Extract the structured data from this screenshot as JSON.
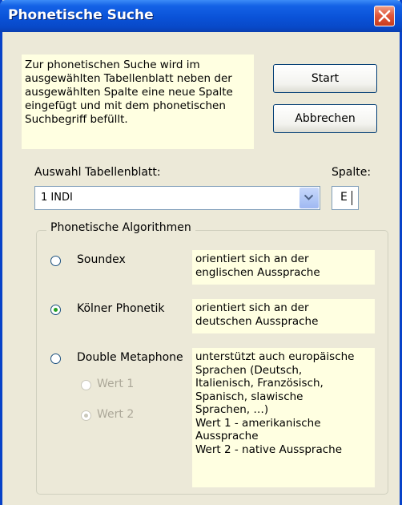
{
  "window": {
    "title": "Phonetische Suche"
  },
  "info_text": "Zur phonetischen Suche wird im ausgewählten Tabellenblatt neben der ausgewählten Spalte eine neue Spalte eingefügt und mit dem phonetischen Suchbegriff befüllt.",
  "buttons": {
    "start": "Start",
    "cancel": "Abbrechen"
  },
  "sheet_select": {
    "label": "Auswahl Tabellenblatt:",
    "value": "1 INDI"
  },
  "column_field": {
    "label": "Spalte:",
    "value": "E"
  },
  "algorithms": {
    "group_label": "Phonetische Algorithmen",
    "options": [
      {
        "label": "Soundex",
        "selected": false,
        "description": "orientiert sich an der\nenglischen Aussprache"
      },
      {
        "label": "Kölner Phonetik",
        "selected": true,
        "description": "orientiert sich an der\ndeutschen Aussprache"
      },
      {
        "label": "Double Metaphone",
        "selected": false,
        "description": "unterstützt auch europäische\nSprachen (Deutsch,\nItalienisch, Französisch,\nSpanisch, slawische\nSprachen, …)\nWert 1 - amerikanische\nAussprache\nWert 2 - native Aussprache"
      }
    ],
    "sub_options": [
      {
        "label": "Wert 1",
        "selected": false,
        "enabled": false
      },
      {
        "label": "Wert 2",
        "selected": true,
        "enabled": false
      }
    ]
  },
  "colors": {
    "titlebar": "#0a52d8",
    "dialog_bg": "#ece9d8",
    "info_bg": "#ffffe1",
    "radio_selected": "#21a121"
  }
}
